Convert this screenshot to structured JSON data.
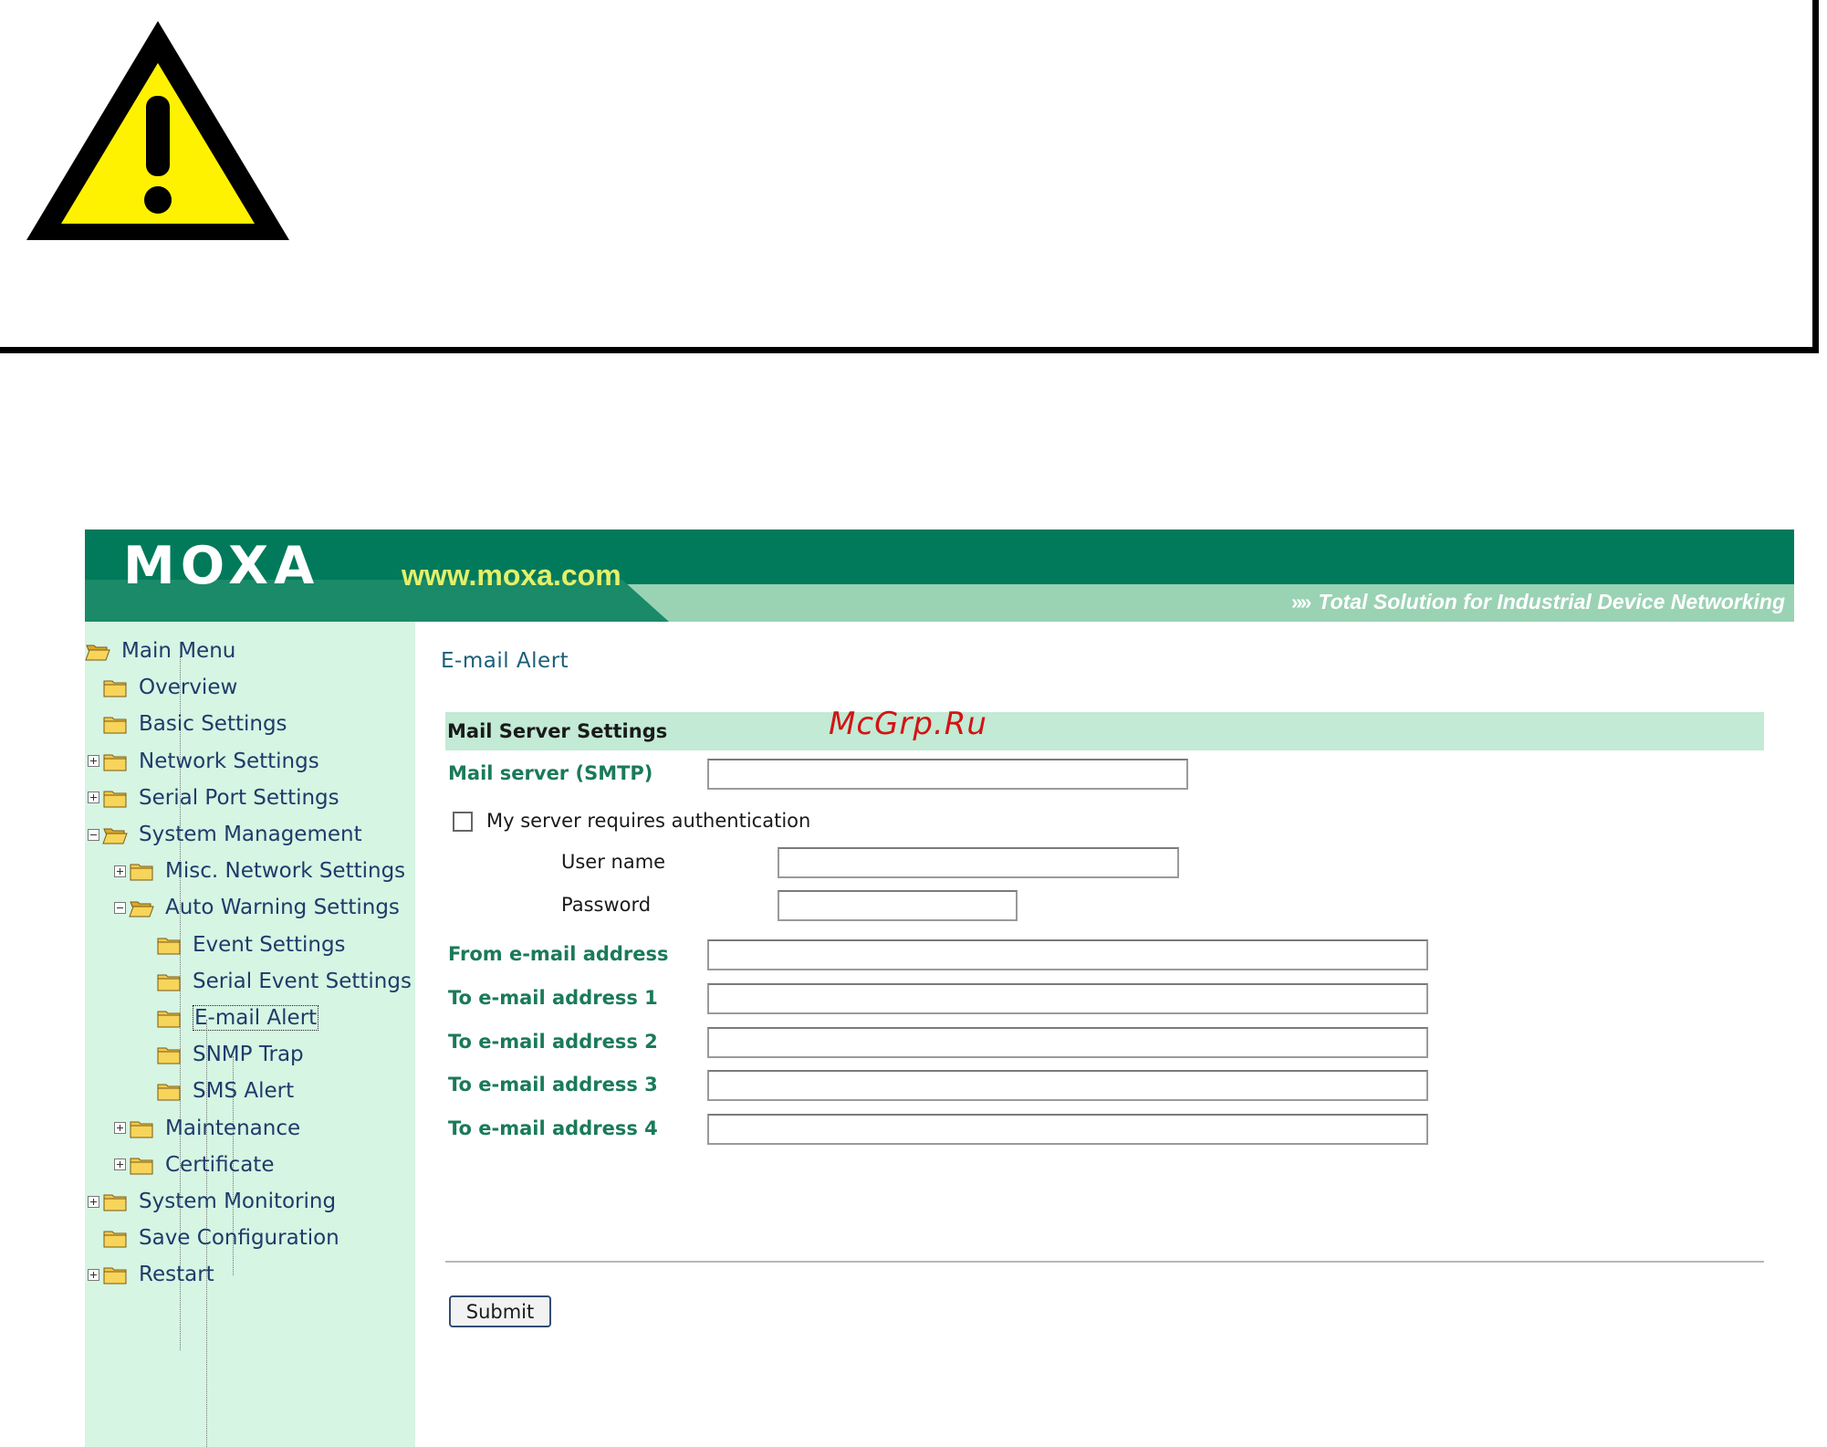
{
  "warning": {
    "icon": "warning-triangle-icon",
    "colors": {
      "fill": "#fff200",
      "outline": "#000000"
    }
  },
  "banner": {
    "logo": "MOXA",
    "url": "www.moxa.com",
    "tagline_icon": "double-chevron-right-icon",
    "tagline": "Total Solution for Industrial Device Networking",
    "colors": {
      "green": "#007a5a",
      "light_green": "#9ad2b4",
      "url_yellow": "#e4f06a"
    }
  },
  "sidebar": {
    "root": "Main Menu",
    "items": [
      {
        "label": "Overview",
        "expander": "none",
        "icon": "folder-icon"
      },
      {
        "label": "Basic Settings",
        "expander": "none",
        "icon": "folder-icon"
      },
      {
        "label": "Network Settings",
        "expander": "plus",
        "icon": "folder-icon"
      },
      {
        "label": "Serial Port Settings",
        "expander": "plus",
        "icon": "folder-icon"
      },
      {
        "label": "System Management",
        "expander": "minus",
        "icon": "folder-open-icon"
      },
      {
        "label": "Misc. Network Settings",
        "expander": "plus",
        "icon": "folder-icon"
      },
      {
        "label": "Auto Warning Settings",
        "expander": "minus",
        "icon": "folder-open-icon"
      },
      {
        "label": "Event Settings",
        "expander": "none",
        "icon": "folder-icon"
      },
      {
        "label": "Serial Event Settings",
        "expander": "none",
        "icon": "folder-icon"
      },
      {
        "label": "E-mail Alert",
        "expander": "none",
        "icon": "folder-icon",
        "selected": true
      },
      {
        "label": "SNMP Trap",
        "expander": "none",
        "icon": "folder-icon"
      },
      {
        "label": "SMS Alert",
        "expander": "none",
        "icon": "folder-icon"
      },
      {
        "label": "Maintenance",
        "expander": "plus",
        "icon": "folder-icon"
      },
      {
        "label": "Certificate",
        "expander": "plus",
        "icon": "folder-icon"
      },
      {
        "label": "System Monitoring",
        "expander": "plus",
        "icon": "folder-icon"
      },
      {
        "label": "Save Configuration",
        "expander": "none",
        "icon": "folder-icon"
      },
      {
        "label": "Restart",
        "expander": "plus",
        "icon": "folder-icon"
      }
    ],
    "colors": {
      "background": "#d6f5e3",
      "text": "#1f3b6a",
      "folder": "#f2c84b"
    }
  },
  "content": {
    "page_title": "E-mail Alert",
    "section_title": "Mail Server Settings",
    "watermark": "McGrp.Ru",
    "fields": {
      "smtp": {
        "label": "Mail server (SMTP)",
        "value": ""
      },
      "auth": {
        "label": "My server requires authentication",
        "checked": false
      },
      "username": {
        "label": "User name",
        "value": ""
      },
      "password": {
        "label": "Password",
        "value": ""
      },
      "from": {
        "label": "From e-mail address",
        "value": ""
      },
      "to1": {
        "label": "To e-mail address 1",
        "value": ""
      },
      "to2": {
        "label": "To e-mail address 2",
        "value": ""
      },
      "to3": {
        "label": "To e-mail address 3",
        "value": ""
      },
      "to4": {
        "label": "To e-mail address 4",
        "value": ""
      }
    },
    "submit_label": "Submit",
    "colors": {
      "title": "#1b5e7a",
      "label_green": "#1a7a5a",
      "section_bar": "#c2ead4",
      "watermark": "#d21414"
    }
  }
}
